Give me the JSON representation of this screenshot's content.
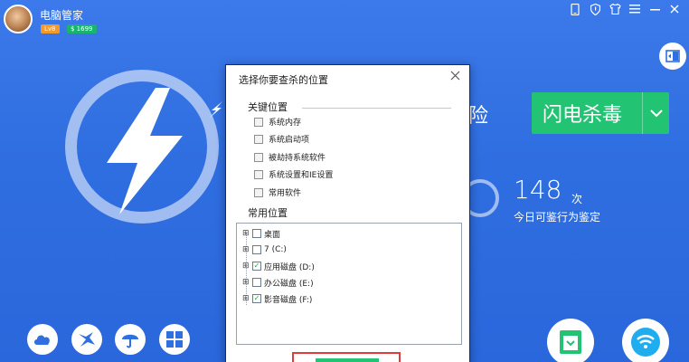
{
  "header": {
    "app_title": "电脑管家",
    "level_badge": "Lv8",
    "coin_badge": "$ 1699"
  },
  "window_icons": [
    "phone-icon",
    "shield-icon",
    "shirt-icon",
    "menu-icon",
    "minimize-icon",
    "close-icon"
  ],
  "main": {
    "partial_check_text": "险",
    "flash_button_label": "闪电杀毒",
    "count_value": "148",
    "count_unit": "次",
    "count_description": "今日可鉴行为鉴定"
  },
  "dialog": {
    "title": "选择你要查杀的位置",
    "key_section_title": "关键位置",
    "key_items": [
      {
        "label": "系统内存",
        "checked": false
      },
      {
        "label": "系统启动项",
        "checked": false
      },
      {
        "label": "被劫持系统软件",
        "checked": false
      },
      {
        "label": "系统设置和IE设置",
        "checked": false
      },
      {
        "label": "常用软件",
        "checked": false
      }
    ],
    "common_section_title": "常用位置",
    "tree_items": [
      {
        "label": "桌面",
        "checked": false
      },
      {
        "label": "7 (C:)",
        "checked": false
      },
      {
        "label": "应用磁盘 (D:)",
        "checked": true
      },
      {
        "label": "办公磁盘 (E:)",
        "checked": false
      },
      {
        "label": "影音磁盘 (F:)",
        "checked": true
      }
    ]
  },
  "colors": {
    "background_blue": "#2f6fe0",
    "accent_green": "#23c374",
    "highlight_red": "#e33b3b"
  }
}
